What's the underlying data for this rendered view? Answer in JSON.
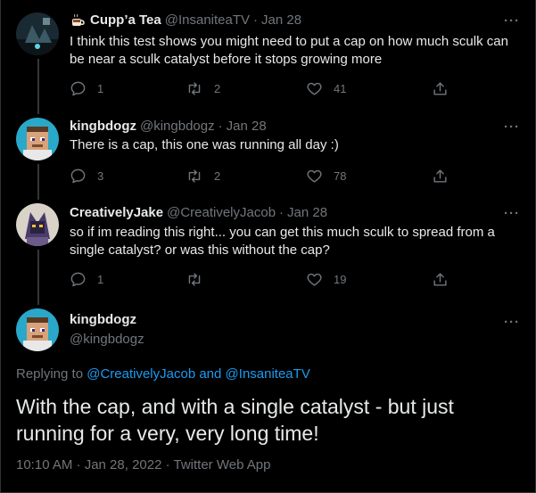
{
  "tweets": [
    {
      "name": "Cupp’a Tea",
      "handle": "@InsaniteaTV",
      "sep": "·",
      "date": "Jan 28",
      "text": "I think this test shows you might need to put a cap on how much sculk can be near a sculk catalyst before it stops growing more",
      "replies": "1",
      "retweets": "2",
      "likes": "41"
    },
    {
      "name": "kingbdogz",
      "handle": "@kingbdogz",
      "sep": "·",
      "date": "Jan 28",
      "text": "There is a cap, this one was running all day :)",
      "replies": "3",
      "retweets": "2",
      "likes": "78"
    },
    {
      "name": "CreativelyJake",
      "handle": "@CreativelyJacob",
      "sep": "·",
      "date": "Jan 28",
      "text": "so if im reading this right... you can get this much sculk to spread from a single catalyst? or was this without the cap?",
      "replies": "1",
      "retweets": "",
      "likes": "19"
    }
  ],
  "main": {
    "name": "kingbdogz",
    "handle": "@kingbdogz",
    "replying_prefix": "Replying to ",
    "replying_user1": "@CreativelyJacob",
    "replying_and": " and ",
    "replying_user2": "@InsaniteaTV",
    "text": "With the cap, and with a single catalyst - but just running for a very, very long time!",
    "timestamp": "10:10 AM · Jan 28, 2022 · Twitter Web App"
  },
  "icons": {
    "reply": "reply-icon",
    "retweet": "retweet-icon",
    "like": "like-icon",
    "share": "share-icon",
    "more": "more-icon"
  },
  "colors": {
    "background": "#000000",
    "text": "#e7e9ea",
    "secondary": "#71767b",
    "link": "#1d9bf0"
  }
}
